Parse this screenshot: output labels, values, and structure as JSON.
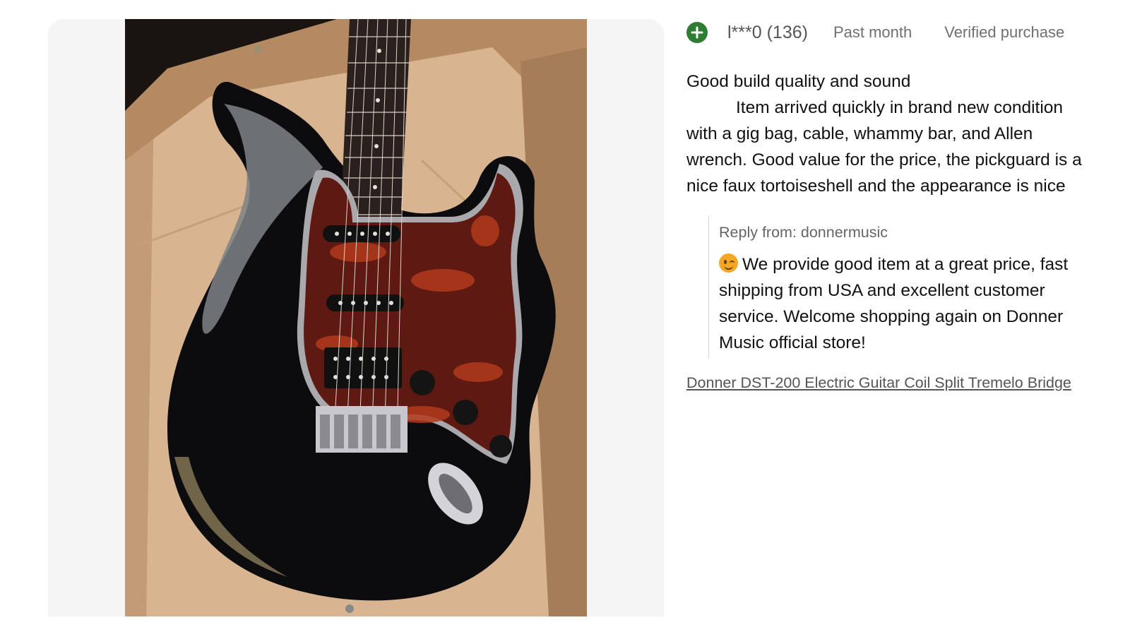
{
  "photo": {
    "description_icon": "review-photo",
    "colors": {
      "box": "#c9a47e",
      "guitar_body": "#111111",
      "pickguard": "#6a1c12",
      "panel_bg": "#f5f5f5"
    }
  },
  "review": {
    "avatar_icon": "plus-circle-icon",
    "avatar_color": "#2e7d32",
    "reviewer": "l***0 (136)",
    "time": "Past month",
    "badge": "Verified purchase",
    "headline": "Good build quality and sound",
    "content": "Item arrived quickly in brand new condition with a gig bag, cable, whammy bar, and Allen wrench. Good value for the price, the pickguard is a nice faux tortoiseshell and the appearance is nice",
    "reply": {
      "from": "Reply from: donnermusic",
      "emoji_icon": "wink-face-icon",
      "text": "We provide good item at a great price, fast shipping from USA and excellent customer service. Welcome shopping again on Donner Music official store!"
    },
    "product_link": "Donner DST-200 Electric Guitar Coil Split Tremelo Bridge"
  }
}
